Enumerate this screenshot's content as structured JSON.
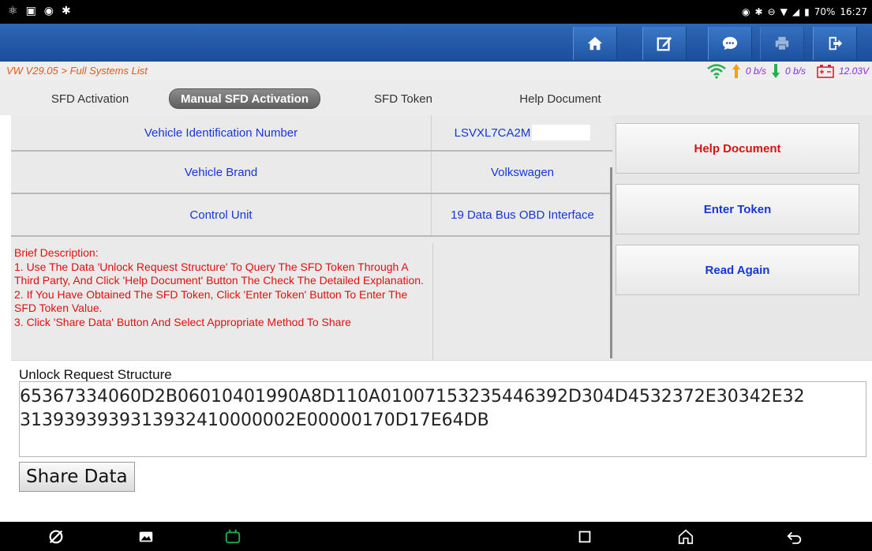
{
  "statusbar": {
    "battery": "70%",
    "time": "16:27",
    "icons": [
      "usb-debug-icon",
      "gallery-icon",
      "record-icon",
      "bluetooth-icon",
      "location-icon",
      "do-not-disturb-icon",
      "wifi-icon",
      "signal-icon",
      "battery-icon"
    ]
  },
  "toolbar": {
    "buttons": [
      "home-icon",
      "edit-report-icon",
      "chat-icon",
      "print-icon",
      "exit-icon"
    ]
  },
  "breadcrumb": {
    "text": "VW V29.05 > Full Systems List"
  },
  "netstat": {
    "upload": "0 b/s",
    "download": "0 b/s",
    "voltage": "12.03V"
  },
  "tabs": [
    {
      "label": "SFD Activation",
      "active": false
    },
    {
      "label": "Manual SFD Activation",
      "active": true
    },
    {
      "label": "SFD Token",
      "active": false
    },
    {
      "label": "Help Document",
      "active": false
    }
  ],
  "grid": {
    "rows": [
      {
        "label": "Vehicle Identification Number",
        "value": "LSVXL7CA2M"
      },
      {
        "label": "Vehicle Brand",
        "value": "Volkswagen"
      },
      {
        "label": "Control Unit",
        "value": "19 Data Bus OBD Interface"
      }
    ],
    "description": [
      "Brief Description:",
      "1. Use The Data 'Unlock Request Structure' To Query The SFD Token Through A Third Party, And Click 'Help Document' Button The Check The Detailed Explanation.",
      "2. If You Have Obtained The SFD Token, Click 'Enter Token' Button To Enter The SFD Token Value.",
      "3. Click 'Share Data' Button And Select Appropriate Method To Share"
    ]
  },
  "actions": {
    "help_document": "Help Document",
    "enter_token": "Enter Token",
    "read_again": "Read Again"
  },
  "unlock": {
    "label": "Unlock Request Structure",
    "value": "65367334060D2B06010401990A8D110A0100715323544639 2D304D4532372E30342E32313939393931393241000000 2E00000170D17E64DB",
    "line1": "65367334060D2B06010401990A8D110A010071532354463 92D304D4532372E30342E",
    "share_label": "Share Data"
  },
  "colors": {
    "accent_blue": "#1b4d9c",
    "label_blue": "#1637d6",
    "warn_red": "#d11414",
    "crumb_orange": "#e05a18"
  }
}
